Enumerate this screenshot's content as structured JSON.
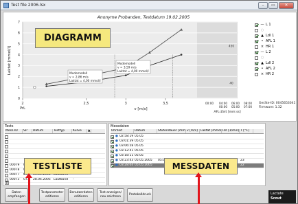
{
  "window": {
    "title": "Test file 2006.lsx",
    "min_label": "–",
    "max_label": "▭",
    "close_label": "✕"
  },
  "annotations": {
    "diagramm": "DIAGRAMM",
    "testliste": "TESTLISTE",
    "messdaten": "MESSDATEN",
    "arrow_color": "#e2141b",
    "label_fill": "#f5e87e"
  },
  "chart_data": {
    "type": "line",
    "title": "Anonyme Probanden, Testdatum 19.02.2005",
    "ylabel": "Laktat [mmol/l]",
    "xlabel_left": "PrL",
    "xlabel": "v [m/s]",
    "xlabel_right": "AFL-Zeit [mm:ss]",
    "ylim": [
      0,
      7
    ],
    "xlim": [
      1.7,
      4.4
    ],
    "y_ticks": [
      "0",
      "1",
      "2",
      "3",
      "4",
      "5",
      "6",
      "7"
    ],
    "x_ticks": [
      {
        "value": 1.7,
        "label": "2"
      },
      {
        "value": 2.5,
        "label": "2,5"
      },
      {
        "value": 3,
        "label": "3"
      },
      {
        "value": 3.5,
        "label": "3,5"
      }
    ],
    "x_ticks_time": [
      "00:00",
      "04:00",
      "06:00",
      "08:00"
    ],
    "x_ticks_time_sub": [
      "00:00",
      "05:00",
      "07:00"
    ],
    "right_ticks": [
      "450",
      "40"
    ],
    "series": [
      {
        "name": "L 1",
        "x": [
          2.0,
          2.5,
          3.0,
          3.3,
          3.7
        ],
        "y": [
          1.3,
          2.0,
          2.8,
          4.2,
          6.3
        ]
      },
      {
        "name": "L 2",
        "x": [
          2.0,
          2.5,
          3.0,
          3.3,
          3.7
        ],
        "y": [
          1.1,
          1.5,
          2.1,
          3.0,
          4.0
        ]
      }
    ],
    "callouts": [
      {
        "lines": [
          "Modemodell",
          "v = 2,86 m/s",
          "Laktat = 4,00 mmol/l"
        ]
      },
      {
        "lines": [
          "Modemodell",
          "v = 3,59 m/s",
          "Laktat = 4,00 mmol/l"
        ]
      }
    ]
  },
  "legend": [
    {
      "label": "L 1",
      "symbol": "—",
      "checked": true,
      "dim": false
    },
    {
      "label": "",
      "symbol": "○",
      "checked": false,
      "dim": true
    },
    {
      "label": "Ldl 1",
      "symbol": "▲",
      "checked": true,
      "dim": false
    },
    {
      "label": "AFL 1",
      "symbol": "•",
      "checked": true,
      "dim": false
    },
    {
      "label": "HR 1",
      "symbol": "×",
      "checked": false,
      "dim": false
    },
    {
      "label": "L 2",
      "symbol": "—",
      "checked": true,
      "dim": false
    },
    {
      "label": "",
      "symbol": "○",
      "checked": false,
      "dim": true
    },
    {
      "label": "Ldl 2",
      "symbol": "▲",
      "checked": true,
      "dim": false
    },
    {
      "label": "AFL 2",
      "symbol": "•",
      "checked": true,
      "dim": false
    },
    {
      "label": "HR 2",
      "symbol": "×",
      "checked": false,
      "dim": false
    }
  ],
  "device": {
    "line1": "Geräte-ID: 0045653041",
    "line2": "Firmware: 1.32"
  },
  "tests": {
    "caption": "Tests",
    "headers": [
      "Mess-ID",
      "SP",
      "Datum",
      "Testtyp",
      "Kurve"
    ],
    "rows": [
      {
        "id": "",
        "sp": "",
        "date": "",
        "type": "",
        "curve": "",
        "checked": false
      },
      {
        "id": "",
        "sp": "",
        "date": "",
        "type": "",
        "curve": "",
        "checked": false
      },
      {
        "id": "",
        "sp": "",
        "date": "",
        "type": "",
        "curve": "",
        "checked": false
      },
      {
        "id": "",
        "sp": "",
        "date": "",
        "type": "",
        "curve": "",
        "checked": false
      },
      {
        "id": "",
        "sp": "",
        "date": "",
        "type": "",
        "curve": "",
        "checked": false
      },
      {
        "id": "",
        "sp": "",
        "date": "",
        "type": "",
        "curve": "",
        "checked": false
      },
      {
        "id": "00079",
        "sp": "079",
        "date": "04.05.2005",
        "type": "Laufband",
        "curve": "-",
        "checked": false
      },
      {
        "id": "00078",
        "sp": "075",
        "date": "04.05.2005",
        "type": "Laufband",
        "curve": "-",
        "checked": false
      },
      {
        "id": "00077",
        "sp": "074",
        "date": "04.05.2005",
        "type": "Laufband",
        "curve": "-",
        "checked": false
      },
      {
        "id": "00073",
        "sp": "073",
        "date": "28.04.2005",
        "type": "Laufband",
        "curve": "-",
        "checked": false
      }
    ],
    "footer": "R"
  },
  "measurements": {
    "caption": "Messdaten",
    "headers": [
      "Uhrzeit",
      "Datum",
      "Stufendauer [mm:ss]",
      "v [m/s]",
      "Laktat [mmol/l]",
      "HR [1/min]",
      "T [°C]"
    ],
    "rows": [
      {
        "time": "02:58:19",
        "date": "05.05",
        "dur": "",
        "v": "",
        "lac": "",
        "hr": "",
        "t": "",
        "sel": false
      },
      {
        "time": "03:01:39",
        "date": "05.05",
        "dur": "",
        "v": "",
        "lac": "",
        "hr": "",
        "t": "",
        "sel": false
      },
      {
        "time": "03:06:58",
        "date": "05.05",
        "dur": "",
        "v": "",
        "lac": "",
        "hr": "",
        "t": "",
        "sel": false
      },
      {
        "time": "03:12:41",
        "date": "05.05",
        "dur": "",
        "v": "",
        "lac": "",
        "hr": "",
        "t": "",
        "sel": false
      },
      {
        "time": "03:18:11",
        "date": "05.05",
        "dur": "",
        "v": "",
        "lac": "",
        "hr": "",
        "t": "",
        "sel": false
      },
      {
        "time": "03:23:43",
        "date": "05.05.2005",
        "dur": "05:00 (PC)",
        "v": "3,2",
        "lac": "6,2",
        "hr": "0",
        "t": "23",
        "sel": false
      },
      {
        "time": "03:28:04",
        "date": "05.05.2005",
        "dur": "",
        "v": "3,5",
        "lac": "6,5",
        "hr": "0",
        "t": "22",
        "sel": true
      }
    ]
  },
  "buttons": {
    "daten": "Daten empfangen",
    "testparam": "Testparameter editieren",
    "benutzer": "Benutzerdaten editieren",
    "anzeigen": "Test anzeigen/ neu zeichnen",
    "protokoll": "Protokolldruck"
  },
  "logo": {
    "line1": "Lactate",
    "line2": "Scout"
  }
}
